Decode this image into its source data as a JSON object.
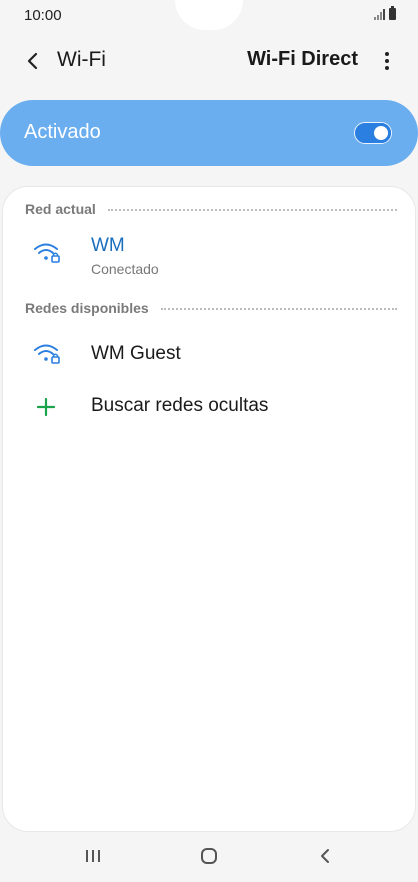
{
  "status_bar": {
    "time": "10:00",
    "icons": [
      "signal-icon",
      "battery-icon"
    ]
  },
  "header": {
    "title": "Wi-Fi",
    "wifi_direct_label": "Wi-Fi Direct",
    "icons": [
      "back-arrow-icon",
      "more-options-icon"
    ]
  },
  "toggle": {
    "label": "Activado",
    "on": true,
    "accent_color": "#2b7fe0",
    "bar_color": "#6aaef0"
  },
  "current_network": {
    "section_title": "Red actual",
    "name": "WM",
    "status": "Conectado",
    "icon": "wifi-locked-icon"
  },
  "available_networks": {
    "section_title": "Redes disponibles",
    "items": [
      {
        "name": "WM Guest",
        "icon": "wifi-locked-icon"
      }
    ],
    "add_hidden": {
      "label": "Buscar redes ocultas",
      "icon": "plus-icon",
      "color": "#1aa34a"
    }
  },
  "nav_bar": {
    "icons": [
      "recent-apps-icon",
      "home-icon",
      "back-icon"
    ]
  }
}
